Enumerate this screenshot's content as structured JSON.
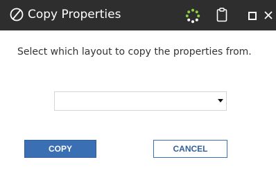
{
  "dialog": {
    "title": "Copy Properties",
    "message": "Select which layout to copy the properties from.",
    "layout_select": {
      "value": ""
    },
    "buttons": {
      "copy": "COPY",
      "cancel": "CANCEL"
    },
    "icons": {
      "title": "no-entry-icon",
      "spinner": "loading-spinner-icon",
      "clipboard": "clipboard-icon",
      "maximize": "maximize-icon",
      "close": "close-icon"
    },
    "colors": {
      "titlebar": "#2e2e2e",
      "accent": "#3a6fb3",
      "spinner_dots": "#8fce3f"
    }
  }
}
